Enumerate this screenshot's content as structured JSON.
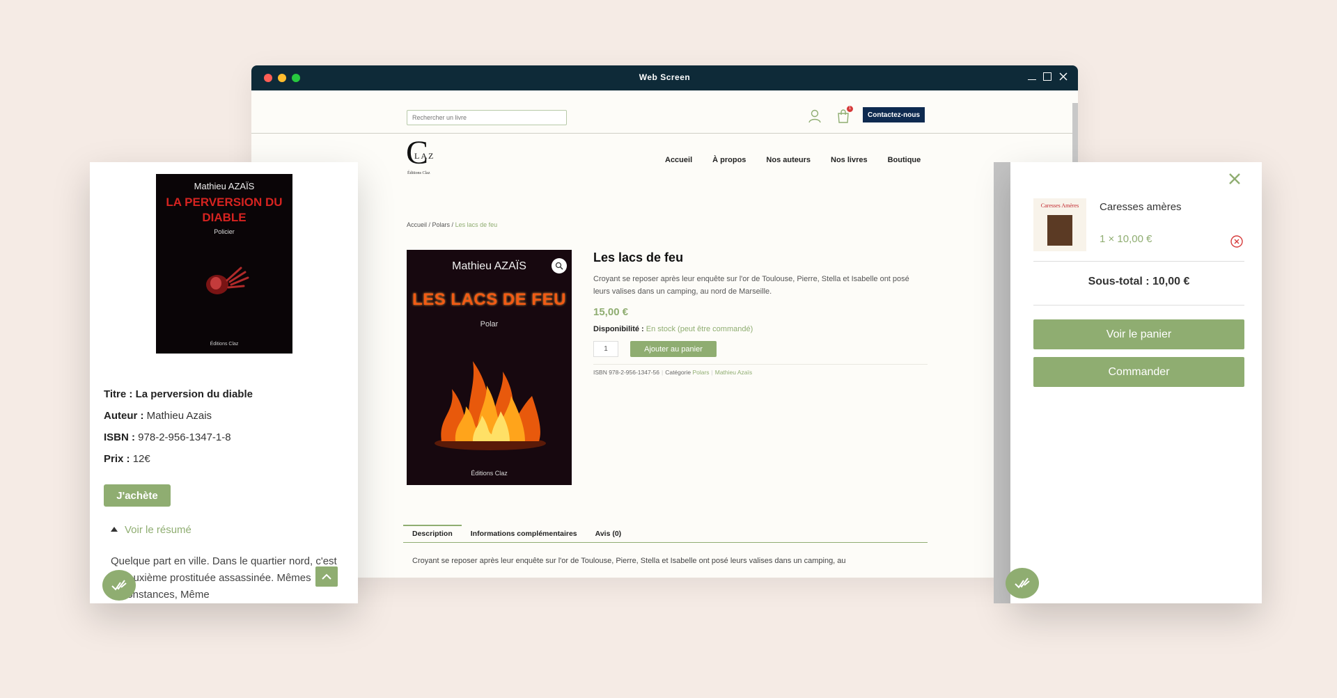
{
  "window": {
    "title": "Web Screen"
  },
  "header": {
    "search_placeholder": "Rechercher un livre",
    "cart_count": "1",
    "contact_label": "Contactez-nous"
  },
  "logo": {
    "initial": "C",
    "letters": "LAZ",
    "subtitle": "Éditions Claz"
  },
  "nav": {
    "items": [
      "Accueil",
      "À propos",
      "Nos auteurs",
      "Nos livres",
      "Boutique"
    ]
  },
  "breadcrumb": {
    "home": "Accueil",
    "sep1": " / ",
    "category": "Polars",
    "sep2": " / ",
    "current": "Les lacs de feu"
  },
  "product": {
    "cover": {
      "author": "Mathieu AZAÏS",
      "title": "LES LACS DE FEU",
      "genre": "Polar",
      "publisher": "Éditions Claz"
    },
    "title": "Les lacs de feu",
    "description": "Croyant se reposer après leur enquête sur l'or de Toulouse, Pierre, Stella et Isabelle ont posé leurs valises dans un camping, au nord de Marseille.",
    "price": "15,00 €",
    "availability_label": "Disponibilité :",
    "availability_value": "En stock (peut être commandé)",
    "quantity": "1",
    "add_to_cart_label": "Ajouter au panier",
    "meta": {
      "isbn": "ISBN 978-2-956-1347-56",
      "category_label": "Catégorie",
      "category": "Polars",
      "author_tag": "Mathieu Azaïs"
    }
  },
  "tabs": {
    "items": [
      "Description",
      "Informations complémentaires",
      "Avis (0)"
    ],
    "active": "Description",
    "content": "Croyant se reposer après leur enquête sur l'or de Toulouse, Pierre, Stella et Isabelle ont posé leurs valises dans un camping, au"
  },
  "mobile_panel": {
    "cover": {
      "author": "Mathieu AZAÏS",
      "title": "LA PERVERSION DU DIABLE",
      "genre": "Policier",
      "publisher": "Éditions Claz"
    },
    "title_label": "Titre :",
    "title_value": "La perversion du diable",
    "author_label": "Auteur :",
    "author_value": "Mathieu Azais",
    "isbn_label": "ISBN :",
    "isbn_value": "978-2-956-1347-1-8",
    "price_label": "Prix :",
    "price_value": "12€",
    "buy_label": "J'achète",
    "summary_toggle": "Voir le résumé",
    "summary_text": "Quelque part en ville. Dans le quartier nord, c'est la deuxième prostituée assassinée. Mêmes circonstances, Même"
  },
  "mini_cart": {
    "item_thumb_title": "Caresses Amères",
    "item_name": "Caresses amères",
    "item_qty_price": "1 × 10,00 €",
    "subtotal_label": "Sous-total :",
    "subtotal_value": "10,00 €",
    "view_cart_label": "Voir le panier",
    "checkout_label": "Commander"
  },
  "colors": {
    "accent_green": "#8fad71",
    "titlebar": "#0e2a38",
    "contact_button": "#0e2a50",
    "background": "#f5ebe5"
  },
  "icons": {
    "user": "user-icon",
    "cart": "cart-icon",
    "zoom": "magnifier-icon",
    "close": "close-icon",
    "remove": "remove-circle-icon",
    "scroll_top": "chevron-up-icon",
    "floating": "check-badge-icon"
  }
}
